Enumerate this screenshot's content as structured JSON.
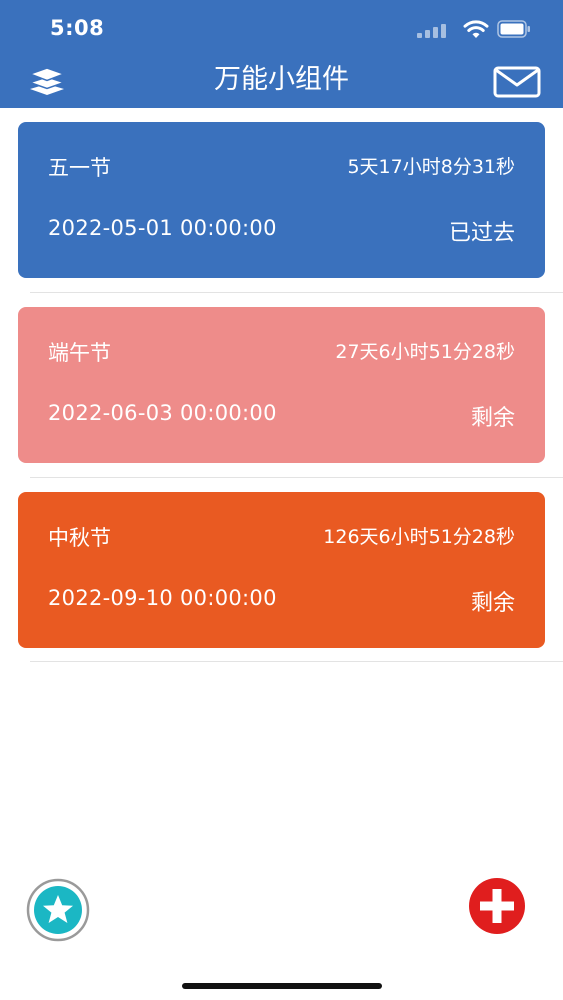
{
  "status_bar": {
    "time": "5:08"
  },
  "nav": {
    "title": "万能小组件",
    "left_icon": "layers-icon",
    "right_icon": "mail-icon"
  },
  "events": [
    {
      "name": "五一节",
      "countdown": "5天17小时8分31秒",
      "date": "2022-05-01 00:00:00",
      "status": "已过去",
      "color": "#3a71bd"
    },
    {
      "name": "端午节",
      "countdown": "27天6小时51分28秒",
      "date": "2022-06-03 00:00:00",
      "status": "剩余",
      "color": "#ee8c8a"
    },
    {
      "name": "中秋节",
      "countdown": "126天6小时51分28秒",
      "date": "2022-09-10 00:00:00",
      "status": "剩余",
      "color": "#e95a22"
    }
  ],
  "bottom": {
    "left_icon": "star-icon",
    "right_icon": "plus-icon"
  },
  "colors": {
    "nav_bg": "#3a71bd",
    "fav_teal": "#1bb7c4",
    "add_red": "#e01e1e"
  }
}
